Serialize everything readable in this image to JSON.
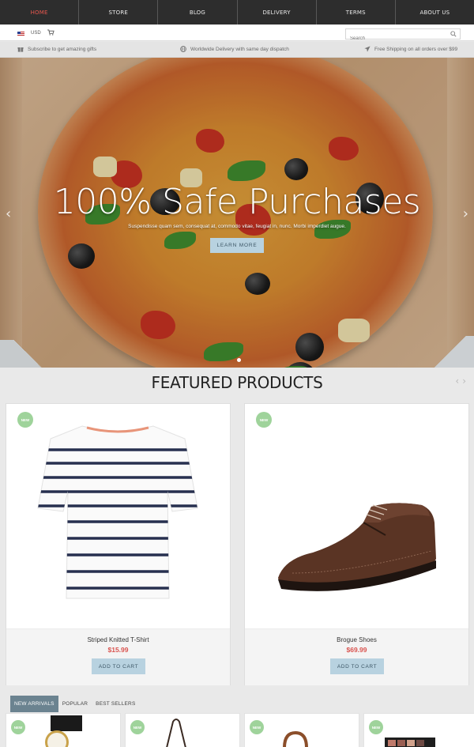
{
  "nav": {
    "items": [
      {
        "label": "HOME",
        "active": true
      },
      {
        "label": "STORE",
        "active": false
      },
      {
        "label": "BLOG",
        "active": false
      },
      {
        "label": "DELIVERY",
        "active": false
      },
      {
        "label": "TERMS",
        "active": false
      },
      {
        "label": "ABOUT US",
        "active": false
      }
    ]
  },
  "topbar": {
    "currency": "USD",
    "search_placeholder": "Search"
  },
  "infobar": {
    "items": [
      {
        "icon": "gift-icon",
        "text": "Subscribe to get amazing gifts"
      },
      {
        "icon": "globe-icon",
        "text": "Worldwide Delivery with same day dispatch"
      },
      {
        "icon": "plane-icon",
        "text": "Free Shipping on all orders over $99"
      }
    ]
  },
  "hero": {
    "title": "100% Safe Purchases",
    "subtitle": "Suspendisse quam sem, consequat at, commodo vitae, feugiat in, nunc. Morbi imperdiet augue.",
    "button": "LEARN MORE",
    "prev_arrow": "‹",
    "next_arrow": "›"
  },
  "featured": {
    "title": "FEATURED PRODUCTS",
    "arrows": "‹›",
    "products": [
      {
        "badge": "NEW",
        "name": "Striped Knitted T-Shirt",
        "price": "$15.99",
        "button": "ADD TO CART"
      },
      {
        "badge": "NEW",
        "name": "Brogue Shoes",
        "price": "$69.99",
        "button": "ADD TO CART"
      }
    ]
  },
  "tabs": {
    "items": [
      {
        "label": "NEW ARRIVALS",
        "active": true
      },
      {
        "label": "POPULAR",
        "active": false
      },
      {
        "label": "BEST SELLERS",
        "active": false
      }
    ]
  },
  "mini_products": [
    {
      "badge": "NEW"
    },
    {
      "badge": "NEW"
    },
    {
      "badge": "NEW"
    },
    {
      "badge": "NEW"
    }
  ],
  "colors": {
    "nav_bg": "#2d2d2d",
    "active_nav": "#e6574e",
    "button_bg": "#b8d2e0",
    "price": "#d9534f",
    "badge": "#9fd39b",
    "active_tab": "#6b8390"
  }
}
